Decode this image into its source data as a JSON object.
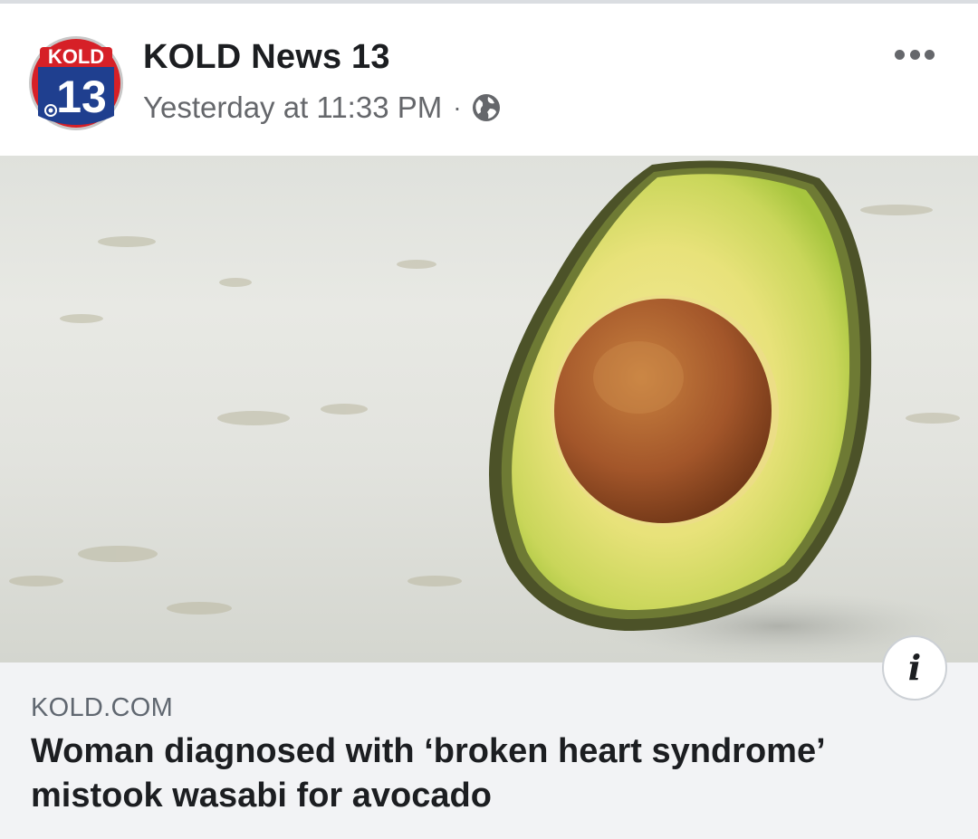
{
  "post": {
    "page_name": "KOLD News 13",
    "timestamp": "Yesterday at 11:33 PM",
    "separator": "·",
    "privacy_icon": "globe-icon",
    "more_icon": "more-options-icon"
  },
  "avatar": {
    "logo_top": "KOLD",
    "logo_number": "13",
    "colors": {
      "red": "#d62027",
      "blue": "#1f3f8f"
    }
  },
  "link": {
    "domain": "KOLD.COM",
    "title": "Woman diagnosed with ‘broken heart syndrome’ mistook wasabi for avocado",
    "image_subject": "halved avocado with pit",
    "info_glyph": "i"
  },
  "colors": {
    "text_primary": "#1c1e21",
    "text_secondary": "#65676b",
    "footer_bg": "#f2f3f5"
  }
}
